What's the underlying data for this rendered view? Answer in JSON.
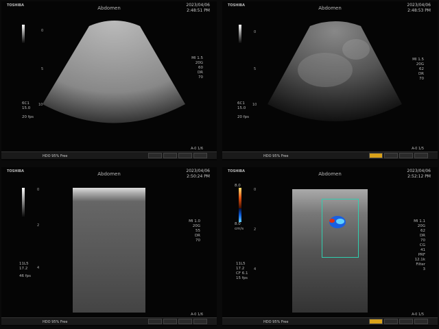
{
  "panels": [
    {
      "brand": "TOSHIBA",
      "label": "Abdomen",
      "date": "2023/04/06",
      "time": "2:48:51 PM",
      "right_params": [
        "MI 1.5",
        "20G",
        "60",
        "DR",
        "70"
      ],
      "left_params": [
        "6C1",
        "15.0",
        "20 fps"
      ],
      "preset": "HDO 95% Free",
      "status": "A-0 1/6"
    },
    {
      "brand": "TOSHIBA",
      "label": "Abdomen",
      "date": "2023/04/06",
      "time": "2:48:53 PM",
      "right_params": [
        "MI 1.5",
        "20G",
        "62",
        "DR",
        "70"
      ],
      "left_params": [
        "6C1",
        "15.0",
        "20 fps"
      ],
      "preset": "HDO 95% Free",
      "status": "A-0 1/5"
    },
    {
      "brand": "TOSHIBA",
      "label": "Abdomen",
      "date": "2023/04/06",
      "time": "2:50:24 PM",
      "right_params": [
        "MI 1.0",
        "20G",
        "55",
        "DR",
        "70"
      ],
      "left_params": [
        "11L5",
        "17.2",
        "46 fps"
      ],
      "preset": "HDO 95% Free",
      "status": "A-0 1/6"
    },
    {
      "brand": "TOSHIBA",
      "label": "Abdomen",
      "date": "2023/04/06",
      "time": "2:52:12 PM",
      "right_params": [
        "MI 1.1",
        "20G",
        "62",
        "DR",
        "70",
        "CG",
        "41",
        "PRF",
        "12.1k",
        "Filter",
        "3"
      ],
      "left_params": [
        "11L5",
        "17.2",
        "CF 6.1",
        "15 fps"
      ],
      "preset": "HDO 95% Free",
      "status": "A-0 1/5",
      "color_scale": [
        "8.0",
        "cm/s",
        "8.0"
      ]
    }
  ]
}
